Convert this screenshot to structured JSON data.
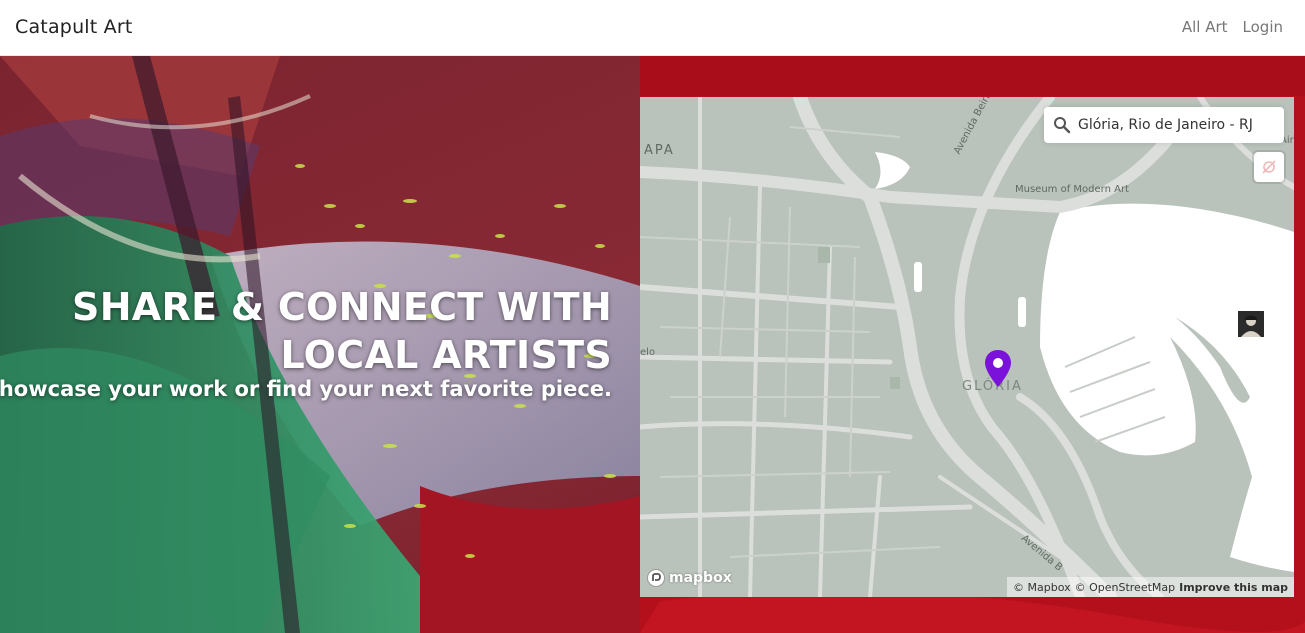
{
  "app": {
    "brand": "Catapult Art",
    "nav": [
      "All Art",
      "Login"
    ]
  },
  "hero": {
    "headline_line1": "SHARE & CONNECT WITH",
    "headline_line2": "LOCAL ARTISTS",
    "subheadline": "Showcase your work or find your next favorite piece."
  },
  "map": {
    "search_value": "Glória, Rio de Janeiro - RJ",
    "labels": {
      "lapa": "APA",
      "avenida_beira_mar": "Avenida Beira Mar",
      "museum": "Museum of Modern Art",
      "gloria": "GLÓRIA",
      "elo": "elo",
      "avenida": "Avenida B",
      "air": "Air"
    },
    "logo": "mapbox",
    "attribution": {
      "mapbox": "© Mapbox",
      "osm": "© OpenStreetMap",
      "improve": "Improve this map"
    },
    "icons": [
      "search-icon",
      "geolocate-disabled-icon",
      "map-pin-icon",
      "mapbox-logo-icon"
    ],
    "colors": {
      "land": "#b9c2bb",
      "road": "#dcdedb",
      "water": "#ffffff",
      "pin": "#7a12d9"
    }
  }
}
